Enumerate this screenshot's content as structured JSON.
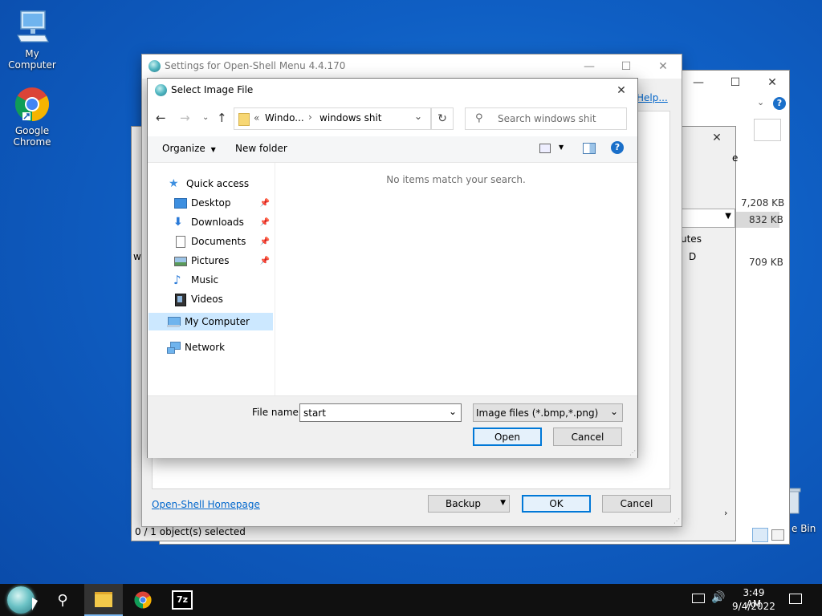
{
  "desktop": {
    "icons": [
      {
        "label": "My Computer"
      },
      {
        "label": "Google Chrome"
      }
    ],
    "recycle_bin_partial": "e Bin"
  },
  "background_explorer": {
    "help_link": "Help...",
    "partial_header_1": "e",
    "sizes": [
      "7,208 KB",
      "832 KB",
      "709 KB"
    ],
    "col_partial": "utes",
    "attr_value": "D",
    "left_partial": "w",
    "status": "0 / 1 object(s) selected"
  },
  "settings": {
    "title": "Settings for Open-Shell Menu 4.4.170",
    "homepage_link": "Open-Shell Homepage",
    "backup_label": "Backup",
    "ok_label": "OK",
    "cancel_label": "Cancel"
  },
  "dialog": {
    "title": "Select Image File",
    "breadcrumb": {
      "prefix": "«",
      "part1": "Windo...",
      "sep": "›",
      "part2": "windows shit"
    },
    "search_placeholder": "Search windows shit",
    "organize_label": "Organize",
    "new_folder_label": "New folder",
    "empty_message": "No items match your search.",
    "nav": {
      "quick_access": "Quick access",
      "desktop": "Desktop",
      "downloads": "Downloads",
      "documents": "Documents",
      "pictures": "Pictures",
      "music": "Music",
      "videos": "Videos",
      "my_computer": "My Computer",
      "network": "Network"
    },
    "file_name_label": "File name:",
    "file_name_value": "start",
    "file_type": "Image files (*.bmp,*.png)",
    "open_label": "Open",
    "cancel_label": "Cancel"
  },
  "taskbar": {
    "time": "3:49 AM",
    "date": "9/4/2022",
    "sevenzip_label": "7z"
  },
  "colors": {
    "accent": "#0078d7",
    "selected_nav": "#cce4f7",
    "link": "#0066cc"
  }
}
